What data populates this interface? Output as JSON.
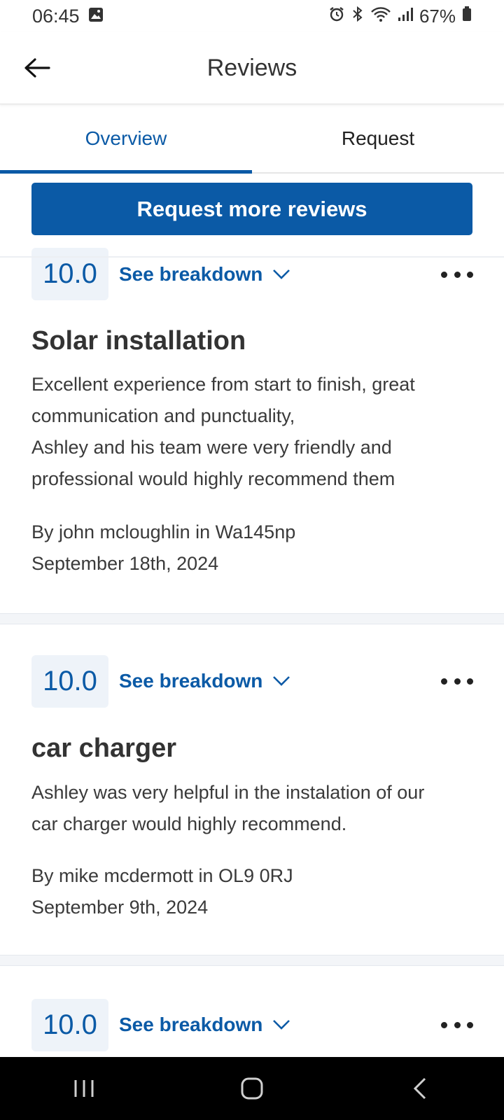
{
  "status_bar": {
    "time": "06:45",
    "battery": "67%"
  },
  "app_bar": {
    "title": "Reviews"
  },
  "tabs": [
    {
      "label": "Overview",
      "active": true
    },
    {
      "label": "Request",
      "active": false
    }
  ],
  "request_button": "Request more reviews",
  "reviews": [
    {
      "score": "10.0",
      "breakdown_label": "See breakdown",
      "title": "Solar installation",
      "body_lines": [
        "Excellent experience from start to finish, great",
        "communication and punctuality,",
        "Ashley and his team were very friendly and",
        "professional would highly recommend them"
      ],
      "author": "By john mcloughlin in Wa145np",
      "date": "September 18th, 2024"
    },
    {
      "score": "10.0",
      "breakdown_label": "See breakdown",
      "title": "car charger",
      "body_lines": [
        "Ashley was very helpful in the instalation of our",
        "car charger would highly recommend."
      ],
      "author": "By mike mcdermott in OL9 0RJ",
      "date": "September 9th, 2024"
    },
    {
      "score": "10.0",
      "breakdown_label": "See breakdown"
    }
  ],
  "colors": {
    "accent": "#0b5aa6",
    "score_bg": "#eef3f9"
  }
}
